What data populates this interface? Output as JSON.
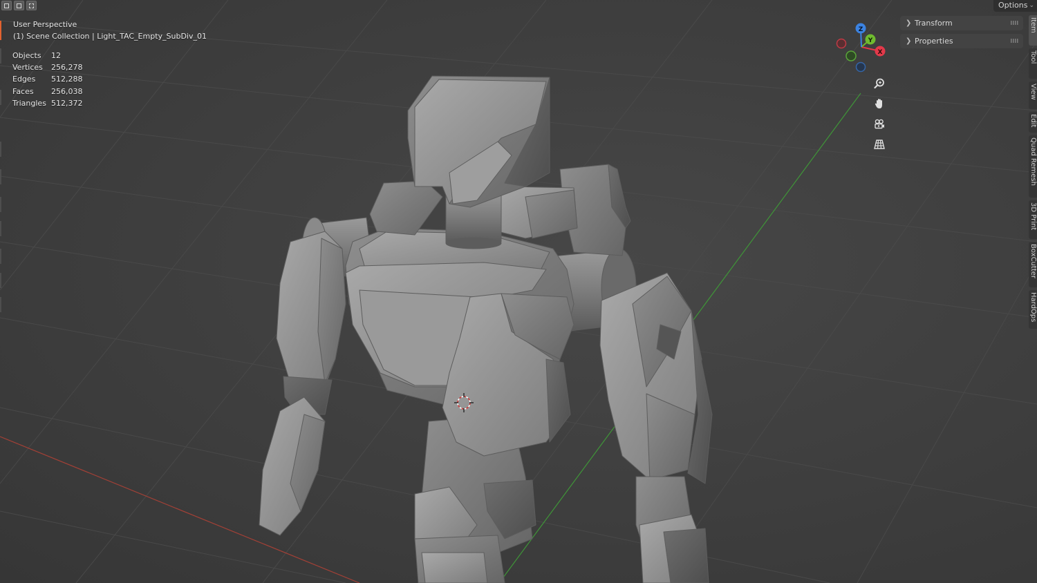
{
  "header": {
    "options_label": "Options"
  },
  "overlay": {
    "view_name": "User Perspective",
    "collection_line": "(1) Scene Collection | Light_TAC_Empty_SubDiv_01"
  },
  "stats": [
    {
      "label": "Objects",
      "value": "12"
    },
    {
      "label": "Vertices",
      "value": "256,278"
    },
    {
      "label": "Edges",
      "value": "512,288"
    },
    {
      "label": "Faces",
      "value": "256,038"
    },
    {
      "label": "Triangles",
      "value": "512,372"
    }
  ],
  "side_panels": [
    {
      "label": "Transform"
    },
    {
      "label": "Properties"
    }
  ],
  "tabs": [
    {
      "label": "Item",
      "active": true
    },
    {
      "label": "Tool",
      "active": false
    },
    {
      "label": "View",
      "active": false
    },
    {
      "label": "Edit",
      "active": false
    },
    {
      "label": "Quad Remesh",
      "active": false
    },
    {
      "label": "3D Print",
      "active": false
    },
    {
      "label": "BoxCutter",
      "active": false
    },
    {
      "label": "HardOps",
      "active": false
    }
  ],
  "gizmo": {
    "x_label": "X",
    "y_label": "Y",
    "z_label": "Z",
    "x_color": "#e3394a",
    "y_color": "#6fbb2f",
    "z_color": "#3b83e2"
  },
  "nav_buttons": [
    {
      "icon": "zoom-icon"
    },
    {
      "icon": "pan-hand-icon"
    },
    {
      "icon": "camera-view-icon"
    },
    {
      "icon": "ortho-grid-icon"
    }
  ],
  "colors": {
    "background": "#3c3c3c",
    "grid_line": "#4a4a4a",
    "x_axis": "#b1443a",
    "y_axis": "#4b9f3e",
    "model": "#858585",
    "active_accent": "#e2622f"
  }
}
